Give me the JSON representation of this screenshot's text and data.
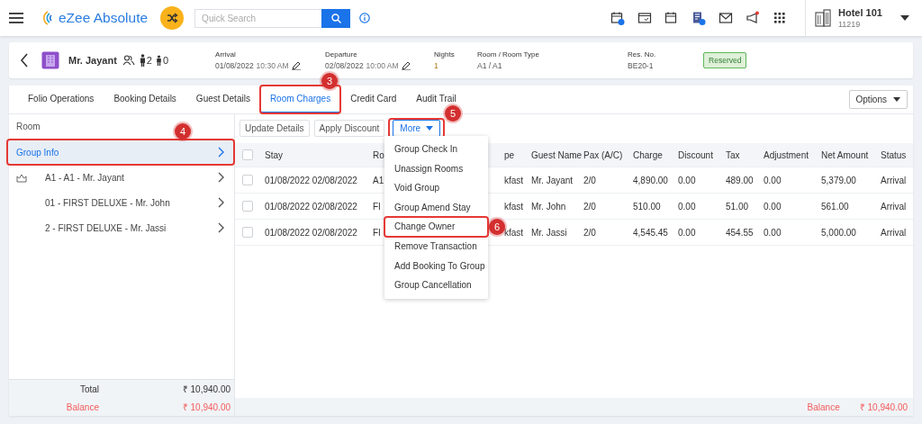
{
  "header": {
    "app_name": "eZee Absolute",
    "search": {
      "placeholder": "Quick Search"
    },
    "hotel": {
      "name": "Hotel 101",
      "code": "11219"
    }
  },
  "guest": {
    "name": "Mr. Jayant",
    "adults": "2",
    "children": "0",
    "status": "Reserved",
    "fields": [
      {
        "label": "Arrival",
        "value": "01/08/2022",
        "time": "10:30 AM",
        "editable": true
      },
      {
        "label": "Departure",
        "value": "02/08/2022",
        "time": "10:00 AM",
        "editable": true
      },
      {
        "label": "Nights",
        "value": "1",
        "kind": "accent"
      },
      {
        "label": "Room / Room Type",
        "value": "A1 / A1"
      },
      {
        "label": "Res. No.",
        "value": "BE20-1"
      }
    ]
  },
  "tabs": [
    {
      "label": "Folio Operations",
      "selected": false
    },
    {
      "label": "Booking Details",
      "selected": false
    },
    {
      "label": "Guest Details",
      "selected": false
    },
    {
      "label": "Room Charges",
      "selected": true,
      "callout": "3"
    },
    {
      "label": "Credit Card",
      "selected": false
    },
    {
      "label": "Audit Trail",
      "selected": false
    }
  ],
  "options_button": "Options",
  "sidebar": {
    "heading": "Room",
    "items": [
      {
        "label": "Group Info",
        "selected": true,
        "kind": "group",
        "callout": "4"
      },
      {
        "label": "A1 - A1 - Mr. Jayant",
        "selected": false,
        "kind": "owner"
      },
      {
        "label": "01 - FIRST DELUXE - Mr. John",
        "selected": false,
        "kind": "room"
      },
      {
        "label": "2 - FIRST DELUXE - Mr. Jassi",
        "selected": false,
        "kind": "room"
      }
    ],
    "total_label": "Total",
    "total": "₹ 10,940.00",
    "balance_label": "Balance",
    "balance": "₹ 10,940.00"
  },
  "toolbar": [
    {
      "label": "Update Details",
      "kind": "button"
    },
    {
      "label": "Apply Discount",
      "kind": "button"
    },
    {
      "label": "More",
      "kind": "dropdown",
      "callout": "5"
    }
  ],
  "menu": [
    {
      "label": "Group Check In"
    },
    {
      "label": "Unassign Rooms"
    },
    {
      "label": "Void Group"
    },
    {
      "label": "Group Amend Stay"
    },
    {
      "label": "Change Owner",
      "callout": "6"
    },
    {
      "label": "Remove Transaction"
    },
    {
      "label": "Add Booking To Group"
    },
    {
      "label": "Group Cancellation"
    }
  ],
  "table": {
    "all_checked": false,
    "columns": [
      "Stay",
      "Ro",
      "pe",
      "Guest Name",
      "Pax (A/C)",
      "Charge",
      "Discount",
      "Tax",
      "Adjustment",
      "Net Amount",
      "Status"
    ],
    "rows": [
      {
        "checked": false,
        "cells": [
          "01/08/2022 02/08/2022",
          "A1",
          "kfast",
          "Mr. Jayant",
          "2/0",
          "4,890.00",
          "0.00",
          "489.00",
          "0.00",
          "5,379.00",
          "Arrival"
        ]
      },
      {
        "checked": false,
        "cells": [
          "01/08/2022 02/08/2022",
          "FI",
          "kfast",
          "Mr. John",
          "2/0",
          "510.00",
          "0.00",
          "51.00",
          "0.00",
          "561.00",
          "Arrival"
        ]
      },
      {
        "checked": false,
        "cells": [
          "01/08/2022 02/08/2022",
          "FI",
          "kfast",
          "Mr. Jassi",
          "2/0",
          "4,545.45",
          "0.00",
          "454.55",
          "0.00",
          "5,000.00",
          "Arrival"
        ]
      }
    ]
  },
  "footer": {
    "balance_label": "Balance",
    "balance": "₹ 10,940.00"
  }
}
